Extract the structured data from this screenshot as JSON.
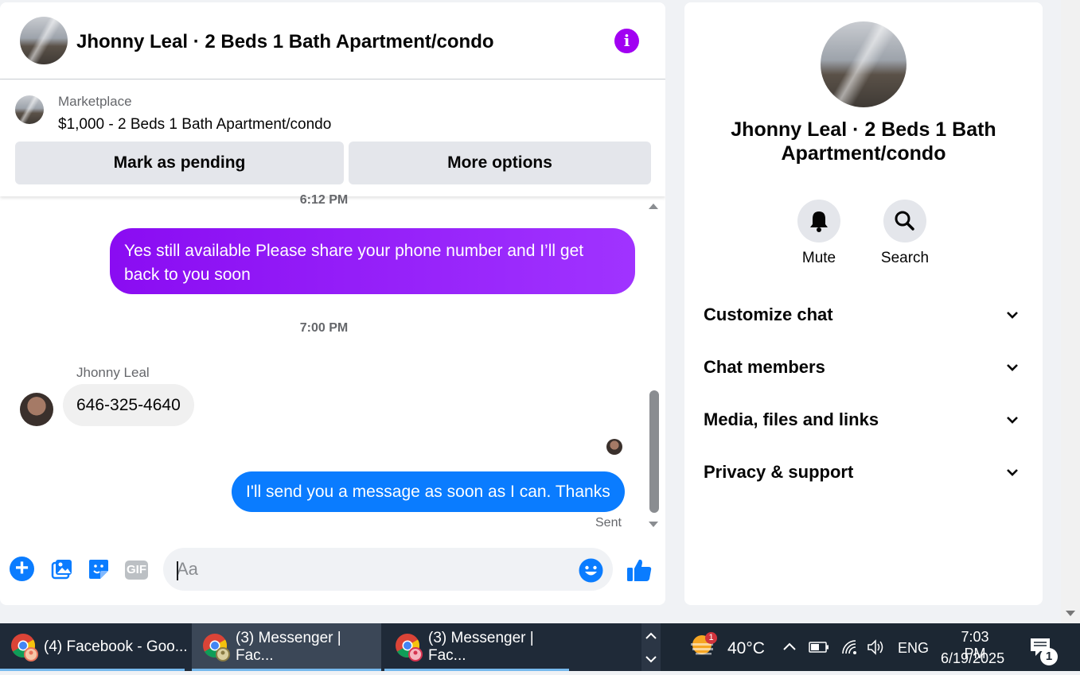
{
  "chat": {
    "title": "Jhonny Leal · 2 Beds 1 Bath Apartment/condo",
    "marketplace_label": "Marketplace",
    "listing": "$1,000 - 2 Beds 1 Bath Apartment/condo",
    "mark_pending": "Mark as pending",
    "more_options": "More options",
    "messages": [
      {
        "time": "6:12 PM",
        "from": "me",
        "text": "Yes still available Please share your phone number and I’ll get back to you soon"
      },
      {
        "time": "7:00 PM",
        "from": "Jhonny Leal",
        "text": "646-325-4640"
      },
      {
        "from": "me",
        "text": "I'll send you a message as soon as I can. Thanks",
        "status": "Sent"
      }
    ],
    "composer_placeholder": "Aa",
    "gif_label": "GIF"
  },
  "info_panel": {
    "title": "Jhonny Leal · 2 Beds 1 Bath Apartment/condo",
    "actions": [
      {
        "label": "Mute",
        "icon": "bell-icon"
      },
      {
        "label": "Search",
        "icon": "search-icon"
      }
    ],
    "sections": [
      "Customize chat",
      "Chat members",
      "Media, files and links",
      "Privacy & support"
    ]
  },
  "taskbar": {
    "tasks": [
      "(4) Facebook - Goo...",
      "(3) Messenger | Fac...",
      "(3) Messenger | Fac..."
    ],
    "weather_badge": "1",
    "temperature": "40°C",
    "language": "ENG",
    "time": "7:03 PM",
    "date": "6/19/2025",
    "notifications": "1"
  },
  "colors": {
    "accent_purple": "#a100f2",
    "bubble_blue": "#0a7cff",
    "taskbar": "#1f2a38"
  }
}
